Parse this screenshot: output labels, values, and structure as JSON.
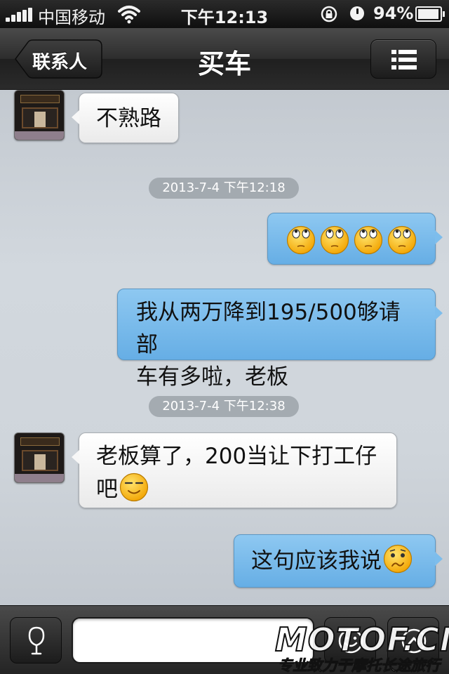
{
  "status_bar": {
    "carrier": "中国移动",
    "time": "下午12:13",
    "battery": "94%",
    "icons": [
      "signal-icon",
      "wifi-icon",
      "orientation-lock-icon",
      "alarm-icon",
      "battery-charging-icon"
    ]
  },
  "nav": {
    "back_label": "联系人",
    "title": "买车",
    "menu_icon": "list-icon"
  },
  "messages": [
    {
      "direction": "in",
      "text": "不熟路"
    },
    {
      "type": "timestamp",
      "text": "2013-7-4 下午12:18"
    },
    {
      "direction": "out",
      "emoji": [
        "rolling-eyes-emoji",
        "rolling-eyes-emoji",
        "rolling-eyes-emoji",
        "rolling-eyes-emoji"
      ]
    },
    {
      "direction": "out",
      "text_line1": "我从两万降到195/500够请部",
      "text_line2": "车有多啦，老板"
    },
    {
      "type": "timestamp",
      "text": "2013-7-4 下午12:38"
    },
    {
      "direction": "in",
      "text_line1": "老板算了，200当让下打工仔",
      "text_line2": "吧",
      "emoji": "smug-emoji"
    },
    {
      "direction": "out",
      "text": "这句应该我说",
      "emoji": "worried-emoji"
    }
  ],
  "input_bar": {
    "voice_icon": "microphone-icon",
    "placeholder": "",
    "emoji_icon": "smiley-icon",
    "more_icon": "chevron-up-icon"
  },
  "watermark": {
    "logo": "MOTOF.CN",
    "tagline": "专业致力于摩托长途旅行"
  },
  "colors": {
    "outgoing_bubble": "#76b8ea",
    "incoming_bubble": "#ffffff",
    "chat_background": "#cfd5db",
    "bar": "#2b2b2b"
  }
}
